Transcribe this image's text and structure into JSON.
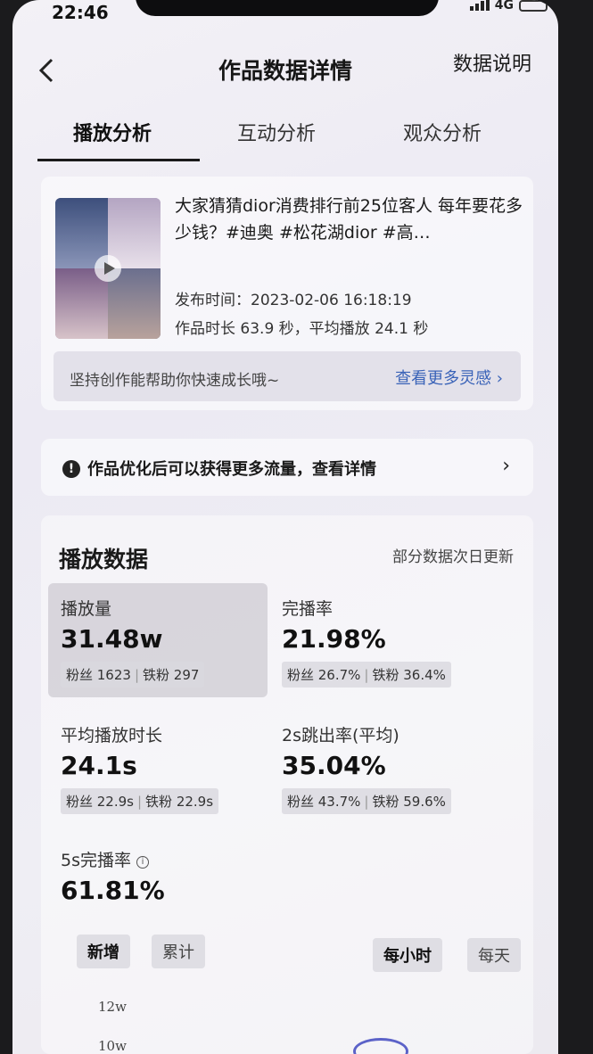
{
  "status": {
    "time": "22:46",
    "network": "4G"
  },
  "header": {
    "title": "作品数据详情",
    "help_label": "数据说明"
  },
  "tabs": [
    {
      "label": "播放分析",
      "active": true
    },
    {
      "label": "互动分析",
      "active": false
    },
    {
      "label": "观众分析",
      "active": false
    }
  ],
  "work": {
    "title": "大家猜猜dior消费排行前25位客人 每年要花多少钱？#迪奥 #松花湖dior #高…",
    "publish_time": "发布时间：2023-02-06 16:18:19",
    "duration_info": "作品时长 63.9 秒，平均播放 24.1 秒",
    "inspire_text": "坚持创作能帮助你快速成长哦~",
    "inspire_link": "查看更多灵感 ›"
  },
  "optimize": {
    "text": "作品优化后可以获得更多流量，查看详情"
  },
  "play_data": {
    "title": "播放数据",
    "note": "部分数据次日更新",
    "metrics": [
      {
        "label": "播放量",
        "value": "31.48w",
        "fans": "粉丝 1623",
        "iron_fans": "铁粉 297",
        "selected": true
      },
      {
        "label": "完播率",
        "value": "21.98%",
        "fans": "粉丝 26.7%",
        "iron_fans": "铁粉 36.4%",
        "selected": false
      },
      {
        "label": "平均播放时长",
        "value": "24.1s",
        "fans": "粉丝 22.9s",
        "iron_fans": "铁粉 22.9s",
        "selected": false
      },
      {
        "label": "2s跳出率(平均)",
        "value": "35.04%",
        "fans": "粉丝 43.7%",
        "iron_fans": "铁粉 59.6%",
        "selected": false
      },
      {
        "label": "5s完播率",
        "value": "61.81%",
        "selected": false
      }
    ],
    "mode_tabs": [
      {
        "label": "新增",
        "active": true
      },
      {
        "label": "累计",
        "active": false
      }
    ],
    "granularity_tabs": [
      {
        "label": "每小时",
        "active": true
      },
      {
        "label": "每天",
        "active": false
      }
    ],
    "y_ticks": [
      "12w",
      "10w"
    ]
  }
}
